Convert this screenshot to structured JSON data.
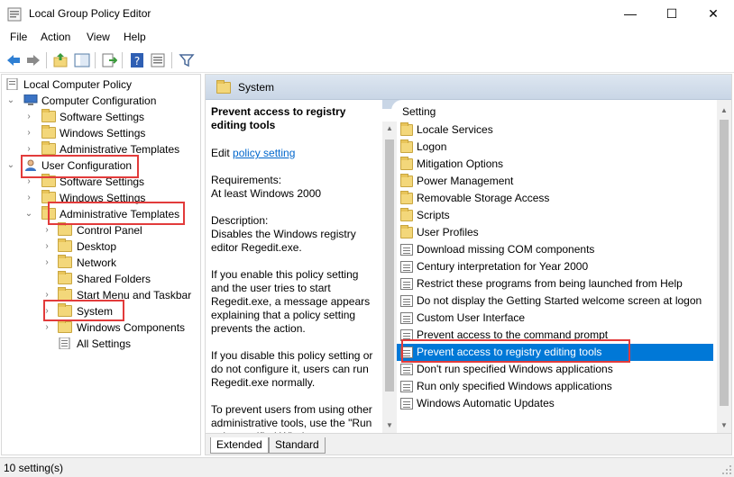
{
  "window": {
    "title": "Local Group Policy Editor",
    "minimize": "—",
    "maximize": "☐",
    "close": "✕"
  },
  "menu": [
    "File",
    "Action",
    "View",
    "Help"
  ],
  "tree": {
    "root": "Local Computer Policy",
    "computer_config": "Computer Configuration",
    "cc_software": "Software Settings",
    "cc_windows": "Windows Settings",
    "cc_admin": "Administrative Templates",
    "user_config": "User Configuration",
    "uc_software": "Software Settings",
    "uc_windows": "Windows Settings",
    "uc_admin": "Administrative Templates",
    "control_panel": "Control Panel",
    "desktop": "Desktop",
    "network": "Network",
    "shared_folders": "Shared Folders",
    "start_menu": "Start Menu and Taskbar",
    "system": "System",
    "windows_components": "Windows Components",
    "all_settings": "All Settings"
  },
  "pane_header": "System",
  "description": {
    "title": "Prevent access to registry editing tools",
    "edit_prefix": "Edit ",
    "edit_link": "policy setting",
    "req_label": "Requirements:",
    "req_value": "At least Windows 2000",
    "desc_label": "Description:",
    "desc_value": "Disables the Windows registry editor Regedit.exe.",
    "para1": "If you enable this policy setting and the user tries to start Regedit.exe, a message appears explaining that a policy setting prevents the action.",
    "para2": "If you disable this policy setting or do not configure it, users can run Regedit.exe normally.",
    "para3": "To prevent users from using other administrative tools, use the \"Run only specified Windows"
  },
  "list": {
    "header": "Setting",
    "items": [
      {
        "label": "Locale Services",
        "type": "folder"
      },
      {
        "label": "Logon",
        "type": "folder"
      },
      {
        "label": "Mitigation Options",
        "type": "folder"
      },
      {
        "label": "Power Management",
        "type": "folder"
      },
      {
        "label": "Removable Storage Access",
        "type": "folder"
      },
      {
        "label": "Scripts",
        "type": "folder"
      },
      {
        "label": "User Profiles",
        "type": "folder"
      },
      {
        "label": "Download missing COM components",
        "type": "policy"
      },
      {
        "label": "Century interpretation for Year 2000",
        "type": "policy"
      },
      {
        "label": "Restrict these programs from being launched from Help",
        "type": "policy"
      },
      {
        "label": "Do not display the Getting Started welcome screen at logon",
        "type": "policy"
      },
      {
        "label": "Custom User Interface",
        "type": "policy"
      },
      {
        "label": "Prevent access to the command prompt",
        "type": "policy"
      },
      {
        "label": "Prevent access to registry editing tools",
        "type": "policy",
        "selected": true
      },
      {
        "label": "Don't run specified Windows applications",
        "type": "policy"
      },
      {
        "label": "Run only specified Windows applications",
        "type": "policy"
      },
      {
        "label": "Windows Automatic Updates",
        "type": "policy"
      }
    ]
  },
  "tabs": {
    "extended": "Extended",
    "standard": "Standard"
  },
  "status": "10 setting(s)",
  "colors": {
    "highlight": "#e23b3b",
    "selection": "#0078d7",
    "link": "#0066cc"
  }
}
